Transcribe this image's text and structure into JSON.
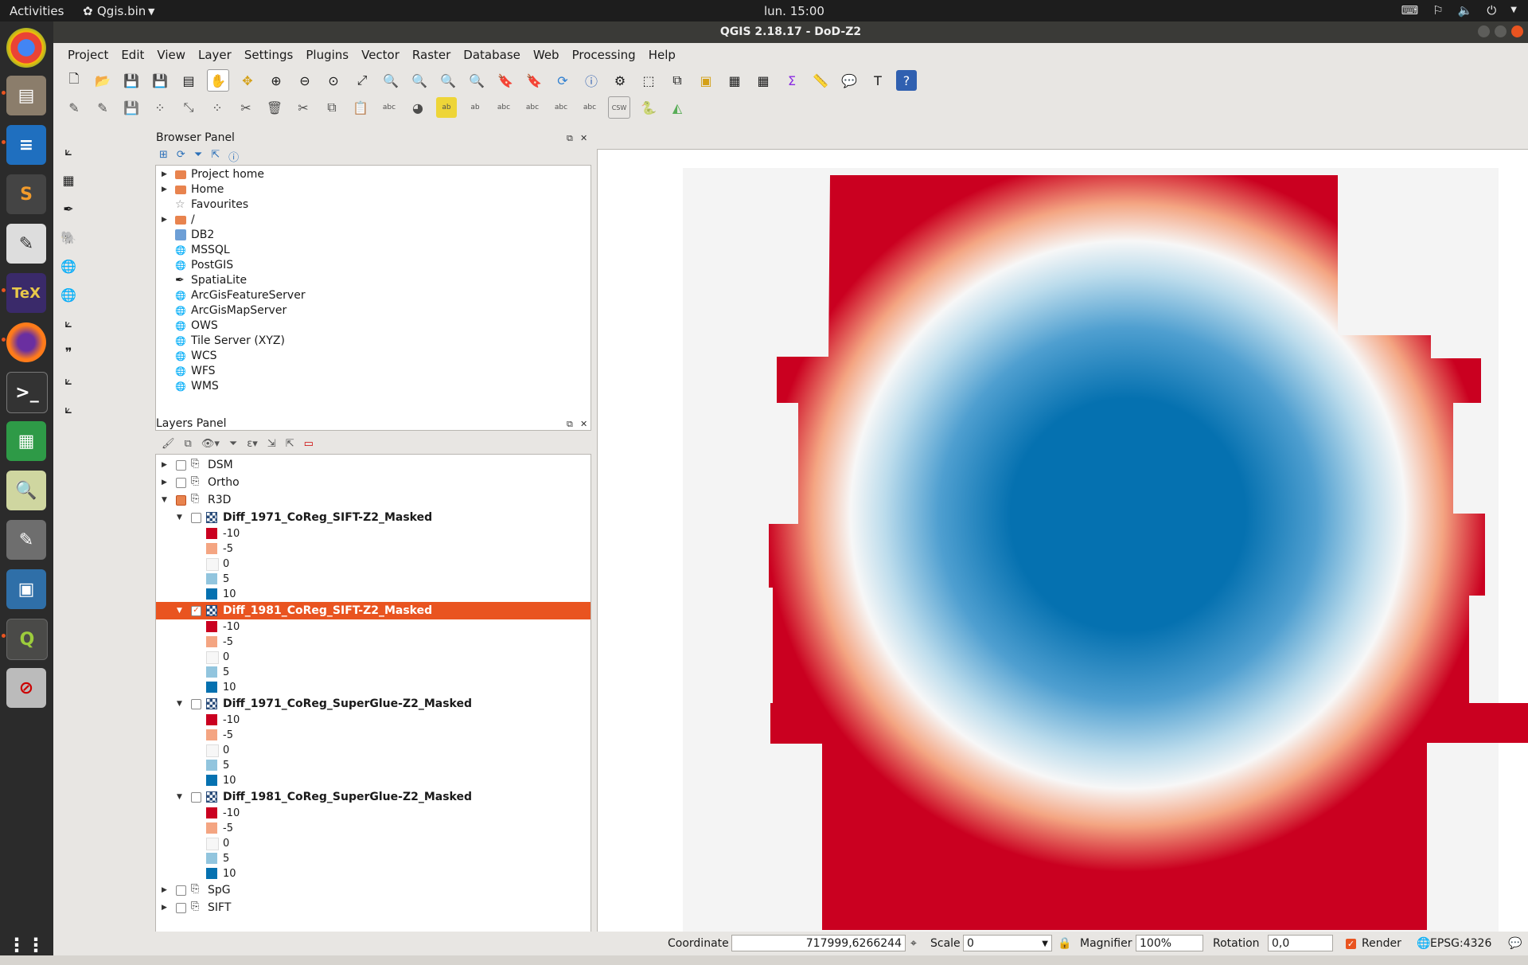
{
  "topbar": {
    "activities": "Activities",
    "app_menu": "Qgis.bin",
    "clock": "lun. 15:00"
  },
  "window": {
    "title": "QGIS 2.18.17 - DoD-Z2"
  },
  "menubar": [
    "Project",
    "Edit",
    "View",
    "Layer",
    "Settings",
    "Plugins",
    "Vector",
    "Raster",
    "Database",
    "Web",
    "Processing",
    "Help"
  ],
  "browser_panel": {
    "title": "Browser Panel",
    "items": [
      {
        "label": "Project home",
        "icon": "folder-icon",
        "expandable": true
      },
      {
        "label": "Home",
        "icon": "folder-icon",
        "expandable": true
      },
      {
        "label": "Favourites",
        "icon": "star-icon",
        "expandable": false
      },
      {
        "label": "/",
        "icon": "folder-icon",
        "expandable": true
      },
      {
        "label": "DB2",
        "icon": "db2-icon",
        "expandable": false
      },
      {
        "label": "MSSQL",
        "icon": "mssql-icon",
        "expandable": false
      },
      {
        "label": "PostGIS",
        "icon": "postgis-icon",
        "expandable": false
      },
      {
        "label": "SpatiaLite",
        "icon": "spatialite-icon",
        "expandable": false
      },
      {
        "label": "ArcGisFeatureServer",
        "icon": "globe-icon",
        "expandable": false
      },
      {
        "label": "ArcGisMapServer",
        "icon": "globe-icon",
        "expandable": false
      },
      {
        "label": "OWS",
        "icon": "globe-icon",
        "expandable": false
      },
      {
        "label": "Tile Server (XYZ)",
        "icon": "globe-icon",
        "expandable": false
      },
      {
        "label": "WCS",
        "icon": "globe-icon",
        "expandable": false
      },
      {
        "label": "WFS",
        "icon": "globe-icon",
        "expandable": false
      },
      {
        "label": "WMS",
        "icon": "globe-icon",
        "expandable": false
      }
    ]
  },
  "layers_panel": {
    "title": "Layers Panel",
    "groups_top": [
      {
        "label": "DSM",
        "checked": false
      },
      {
        "label": "Ortho",
        "checked": false
      }
    ],
    "group_r3d": {
      "label": "R3D"
    },
    "layers": [
      {
        "label": "Diff_1971_CoReg_SIFT-Z2_Masked",
        "checked": false,
        "selected": false
      },
      {
        "label": "Diff_1981_CoReg_SIFT-Z2_Masked",
        "checked": true,
        "selected": true
      },
      {
        "label": "Diff_1971_CoReg_SuperGlue-Z2_Masked",
        "checked": false,
        "selected": false
      },
      {
        "label": "Diff_1981_CoReg_SuperGlue-Z2_Masked",
        "checked": false,
        "selected": false
      }
    ],
    "legend": [
      {
        "label": "-10",
        "color": "#ca0020"
      },
      {
        "label": "-5",
        "color": "#f4a582"
      },
      {
        "label": "0",
        "color": "#f7f7f7"
      },
      {
        "label": "5",
        "color": "#92c5de"
      },
      {
        "label": "10",
        "color": "#0571b0"
      }
    ],
    "groups_bottom": [
      {
        "label": "SpG",
        "checked": false
      },
      {
        "label": "SIFT",
        "checked": false
      }
    ]
  },
  "statusbar": {
    "coordinate_label": "Coordinate",
    "coordinate_value": "717999,6266244",
    "scale_label": "Scale",
    "scale_value": "0",
    "magnifier_label": "Magnifier",
    "magnifier_value": "100%",
    "rotation_label": "Rotation",
    "rotation_value": "0,0",
    "render_label": "Render",
    "crs": "EPSG:4326"
  }
}
